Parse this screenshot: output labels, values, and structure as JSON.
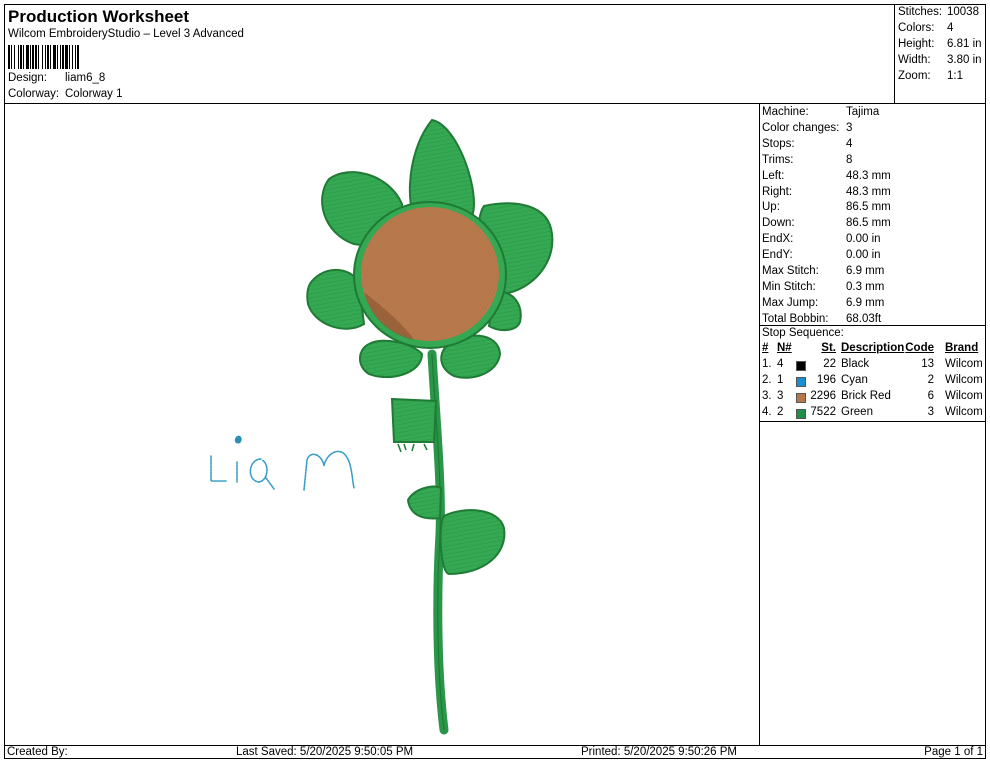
{
  "header": {
    "title": "Production Worksheet",
    "subtitle": "Wilcom EmbroideryStudio – Level 3 Advanced",
    "design_label": "Design:",
    "design_value": "liam6_8",
    "colorway_label": "Colorway:",
    "colorway_value": "Colorway 1"
  },
  "stats": [
    {
      "label": "Stitches:",
      "value": "10038"
    },
    {
      "label": "Colors:",
      "value": "4"
    },
    {
      "label": "Height:",
      "value": "6.81 in"
    },
    {
      "label": "Width:",
      "value": "3.80 in"
    },
    {
      "label": "Zoom:",
      "value": "1:1"
    }
  ],
  "machine": [
    {
      "label": "Machine:",
      "value": "Tajima"
    },
    {
      "label": "Color changes:",
      "value": "3"
    },
    {
      "label": "Stops:",
      "value": "4"
    },
    {
      "label": "Trims:",
      "value": "8"
    },
    {
      "label": "Left:",
      "value": "48.3 mm"
    },
    {
      "label": "Right:",
      "value": "48.3 mm"
    },
    {
      "label": "Up:",
      "value": "86.5 mm"
    },
    {
      "label": "Down:",
      "value": "86.5 mm"
    },
    {
      "label": "EndX:",
      "value": "0.00 in"
    },
    {
      "label": "EndY:",
      "value": "0.00 in"
    },
    {
      "label": "Max Stitch:",
      "value": "6.9 mm"
    },
    {
      "label": "Min Stitch:",
      "value": "0.3 mm"
    },
    {
      "label": "Max Jump:",
      "value": "6.9 mm"
    },
    {
      "label": "Total Bobbin:",
      "value": "68.03ft"
    }
  ],
  "sequence": {
    "title": "Stop Sequence:",
    "columns": {
      "num": "#",
      "n": "N#",
      "st": "St.",
      "desc": "Description",
      "code": "Code",
      "brand": "Brand"
    },
    "rows": [
      {
        "num": "1.",
        "n": "4",
        "color": "#000000",
        "st": "22",
        "desc": "Black",
        "code": "13",
        "brand": "Wilcom"
      },
      {
        "num": "2.",
        "n": "1",
        "color": "#1a8fd0",
        "st": "196",
        "desc": "Cyan",
        "code": "2",
        "brand": "Wilcom"
      },
      {
        "num": "3.",
        "n": "3",
        "color": "#b8764a",
        "st": "2296",
        "desc": "Brick Red",
        "code": "6",
        "brand": "Wilcom"
      },
      {
        "num": "4.",
        "n": "2",
        "color": "#1f8f45",
        "st": "7522",
        "desc": "Green",
        "code": "3",
        "brand": "Wilcom"
      }
    ]
  },
  "footer": {
    "created": "Created By:",
    "saved": "Last Saved: 5/20/2025 9:50:05 PM",
    "printed": "Printed: 5/20/2025 9:50:26 PM",
    "page": "Page 1 of 1"
  },
  "design_text": "liam",
  "colors": {
    "green": "#2e9e4a",
    "green_dark": "#1e7a34",
    "brown": "#b87a4c",
    "cyan": "#3a9fc6"
  }
}
